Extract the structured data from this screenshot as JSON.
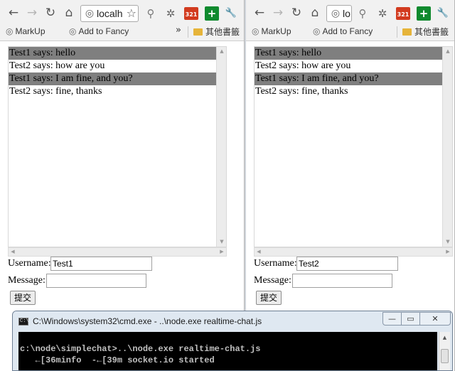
{
  "icons": {
    "back": "←",
    "forward": "→",
    "reload": "↻",
    "home": "⌂",
    "globe": "◎",
    "star": "☆",
    "search": "⚲",
    "gear": "✲",
    "plus": "+",
    "wrench": "🔧",
    "more": "»",
    "scroll_up": "▲",
    "scroll_down": "▼",
    "scroll_left": "◀",
    "scroll_right": "▶",
    "minimize": "—",
    "maximize": "▭",
    "close": "✕"
  },
  "colors": {
    "highlight_row": "#7f7f7f",
    "console_bg": "#000000",
    "console_text": "#c0c0c0",
    "badge_red": "#d23b1f",
    "badge_green": "#0f8a2e"
  },
  "bookmarks": {
    "markup": "MarkUp",
    "fancy": "Add to Fancy",
    "other": "其他書籤"
  },
  "ext_badge_text": "321",
  "left": {
    "address": "localh",
    "messages": [
      {
        "text": "Test1 says: hello",
        "highlighted": true
      },
      {
        "text": "Test2 says: how are you",
        "highlighted": false
      },
      {
        "text": "Test1 says: I am fine, and you?",
        "highlighted": true
      },
      {
        "text": "Test2 says: fine, thanks",
        "highlighted": false
      }
    ],
    "username_label": "Username:",
    "username_value": "Test1",
    "message_label": "Message:",
    "message_value": "",
    "submit_label": "提交"
  },
  "right": {
    "address": "lo",
    "messages": [
      {
        "text": "Test1 says: hello",
        "highlighted": true
      },
      {
        "text": "Test2 says: how are you",
        "highlighted": false
      },
      {
        "text": "Test1 says: I am fine, and you?",
        "highlighted": true
      },
      {
        "text": "Test2 says: fine, thanks",
        "highlighted": false
      }
    ],
    "username_label": "Username:",
    "username_value": "Test2",
    "message_label": "Message:",
    "message_value": "",
    "submit_label": "提交"
  },
  "cmd": {
    "title": "C:\\Windows\\system32\\cmd.exe - ..\\node.exe  realtime-chat.js",
    "icon_text": "C:\\",
    "lines": [
      "c:\\node\\simplechat>..\\node.exe realtime-chat.js",
      "   ←[36minfo  -←[39m socket.io started"
    ]
  }
}
